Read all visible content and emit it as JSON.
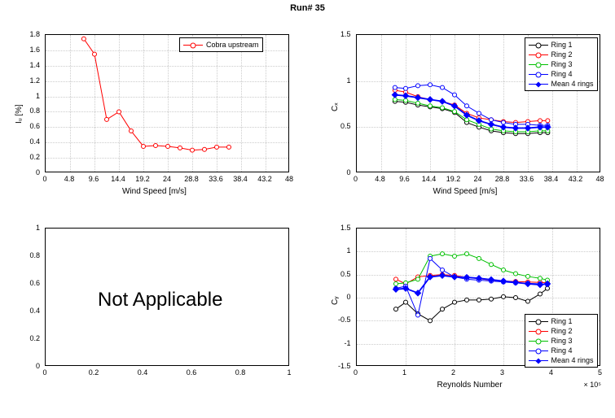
{
  "title": "Run# 35",
  "colors": {
    "ring1": "#000000",
    "ring2": "#ff0000",
    "ring3": "#00c000",
    "ring4": "#0000ff",
    "mean": "#0000ff",
    "cobra": "#ff0000"
  },
  "legend_labels": {
    "cobra": "Cobra upstream",
    "ring1": "Ring 1",
    "ring2": "Ring 2",
    "ring3": "Ring 3",
    "ring4": "Ring 4",
    "mean": "Mean 4 rings"
  },
  "panel_bl": {
    "na_text": "Not Applicable",
    "xlim": [
      0,
      1
    ],
    "ylim": [
      0,
      1
    ],
    "xticks": [
      0,
      0.2,
      0.4,
      0.6,
      0.8,
      1
    ],
    "yticks": [
      0,
      0.2,
      0.4,
      0.6,
      0.8,
      1
    ]
  },
  "chart_data": [
    {
      "id": "tl",
      "type": "line",
      "title": "",
      "xlabel": "Wind Speed [m/s]",
      "ylabel": "Iᵤ [%]",
      "xlim": [
        0,
        48
      ],
      "ylim": [
        0,
        1.8
      ],
      "xticks": [
        0,
        4.8,
        9.6,
        14.4,
        19.2,
        24,
        28.8,
        33.6,
        38.4,
        43.2,
        48
      ],
      "yticks": [
        0,
        0.2,
        0.4,
        0.6,
        0.8,
        1.0,
        1.2,
        1.4,
        1.6,
        1.8
      ],
      "series": [
        {
          "name": "cobra",
          "x": [
            7.5,
            9.6,
            12,
            14.4,
            16.8,
            19.2,
            21.6,
            24,
            26.4,
            28.8,
            31.2,
            33.6,
            36
          ],
          "y": [
            1.75,
            1.55,
            0.7,
            0.8,
            0.55,
            0.35,
            0.36,
            0.35,
            0.33,
            0.3,
            0.31,
            0.34,
            0.34
          ]
        }
      ],
      "legend_pos": "top-right"
    },
    {
      "id": "tr",
      "type": "line",
      "title": "",
      "xlabel": "Wind Speed [m/s]",
      "ylabel": "Cₓ",
      "xlim": [
        0,
        48
      ],
      "ylim": [
        0,
        1.5
      ],
      "xticks": [
        0,
        4.8,
        9.6,
        14.4,
        19.2,
        24,
        28.8,
        33.6,
        38.4,
        43.2,
        48
      ],
      "yticks": [
        0,
        0.5,
        1.0,
        1.5
      ],
      "series": [
        {
          "name": "ring1",
          "x": [
            7.5,
            9.6,
            12,
            14.4,
            16.8,
            19.2,
            21.6,
            24,
            26.4,
            28.8,
            31.2,
            33.6,
            36,
            37.5
          ],
          "y": [
            0.78,
            0.77,
            0.74,
            0.72,
            0.7,
            0.66,
            0.55,
            0.5,
            0.46,
            0.44,
            0.43,
            0.43,
            0.44,
            0.44
          ]
        },
        {
          "name": "ring2",
          "x": [
            7.5,
            9.6,
            12,
            14.4,
            16.8,
            19.2,
            21.6,
            24,
            26.4,
            28.8,
            31.2,
            33.6,
            36,
            37.5
          ],
          "y": [
            0.9,
            0.88,
            0.83,
            0.8,
            0.78,
            0.74,
            0.65,
            0.6,
            0.58,
            0.56,
            0.55,
            0.56,
            0.57,
            0.57
          ]
        },
        {
          "name": "ring3",
          "x": [
            7.5,
            9.6,
            12,
            14.4,
            16.8,
            19.2,
            21.6,
            24,
            26.4,
            28.8,
            31.2,
            33.6,
            36,
            37.5
          ],
          "y": [
            0.8,
            0.79,
            0.76,
            0.73,
            0.71,
            0.67,
            0.58,
            0.53,
            0.48,
            0.46,
            0.45,
            0.45,
            0.46,
            0.46
          ]
        },
        {
          "name": "ring4",
          "x": [
            7.5,
            9.6,
            12,
            14.4,
            16.8,
            19.2,
            21.6,
            24,
            26.4,
            28.8,
            31.2,
            33.6,
            36,
            37.5
          ],
          "y": [
            0.93,
            0.92,
            0.95,
            0.96,
            0.93,
            0.85,
            0.73,
            0.65,
            0.58,
            0.55,
            0.53,
            0.53,
            0.52,
            0.52
          ]
        },
        {
          "name": "mean",
          "x": [
            7.5,
            9.6,
            12,
            14.4,
            16.8,
            19.2,
            21.6,
            24,
            26.4,
            28.8,
            31.2,
            33.6,
            36,
            37.5
          ],
          "y": [
            0.85,
            0.84,
            0.82,
            0.8,
            0.78,
            0.73,
            0.63,
            0.57,
            0.53,
            0.5,
            0.49,
            0.49,
            0.5,
            0.5
          ]
        }
      ],
      "legend_pos": "top-right"
    },
    {
      "id": "br",
      "type": "line",
      "title": "",
      "xlabel": "Reynolds Number",
      "ylabel": "Cᵧ",
      "xlim": [
        0,
        5
      ],
      "ylim": [
        -1.5,
        1.5
      ],
      "xticks": [
        0,
        1,
        2,
        3,
        4,
        5
      ],
      "yticks": [
        -1.5,
        -1,
        -0.5,
        0,
        0.5,
        1,
        1.5
      ],
      "x_exp": "× 10⁵",
      "series": [
        {
          "name": "ring1",
          "x": [
            0.8,
            1.0,
            1.25,
            1.5,
            1.75,
            2.0,
            2.25,
            2.5,
            2.75,
            3.0,
            3.25,
            3.5,
            3.75,
            3.9
          ],
          "y": [
            -0.25,
            -0.1,
            -0.35,
            -0.5,
            -0.25,
            -0.1,
            -0.05,
            -0.05,
            -0.03,
            0.02,
            0.0,
            -0.08,
            0.08,
            0.2
          ]
        },
        {
          "name": "ring2",
          "x": [
            0.8,
            1.0,
            1.25,
            1.5,
            1.75,
            2.0,
            2.25,
            2.5,
            2.75,
            3.0,
            3.25,
            3.5,
            3.75,
            3.9
          ],
          "y": [
            0.4,
            0.3,
            0.45,
            0.48,
            0.5,
            0.48,
            0.44,
            0.41,
            0.38,
            0.36,
            0.35,
            0.34,
            0.33,
            0.32
          ]
        },
        {
          "name": "ring3",
          "x": [
            0.8,
            1.0,
            1.25,
            1.5,
            1.75,
            2.0,
            2.25,
            2.5,
            2.75,
            3.0,
            3.25,
            3.5,
            3.75,
            3.9
          ],
          "y": [
            0.3,
            0.32,
            0.4,
            0.9,
            0.95,
            0.9,
            0.95,
            0.85,
            0.72,
            0.6,
            0.52,
            0.46,
            0.42,
            0.38
          ]
        },
        {
          "name": "ring4",
          "x": [
            0.8,
            1.0,
            1.25,
            1.5,
            1.75,
            2.0,
            2.25,
            2.5,
            2.75,
            3.0,
            3.25,
            3.5,
            3.75,
            3.9
          ],
          "y": [
            0.2,
            0.25,
            -0.38,
            0.85,
            0.6,
            0.45,
            0.4,
            0.38,
            0.36,
            0.34,
            0.32,
            0.31,
            0.3,
            0.29
          ]
        },
        {
          "name": "mean",
          "x": [
            0.8,
            1.0,
            1.25,
            1.5,
            1.75,
            2.0,
            2.25,
            2.5,
            2.75,
            3.0,
            3.25,
            3.5,
            3.75,
            3.9
          ],
          "y": [
            0.18,
            0.2,
            0.1,
            0.45,
            0.48,
            0.45,
            0.44,
            0.42,
            0.39,
            0.36,
            0.33,
            0.3,
            0.28,
            0.3
          ]
        }
      ],
      "legend_pos": "bottom-right"
    }
  ]
}
